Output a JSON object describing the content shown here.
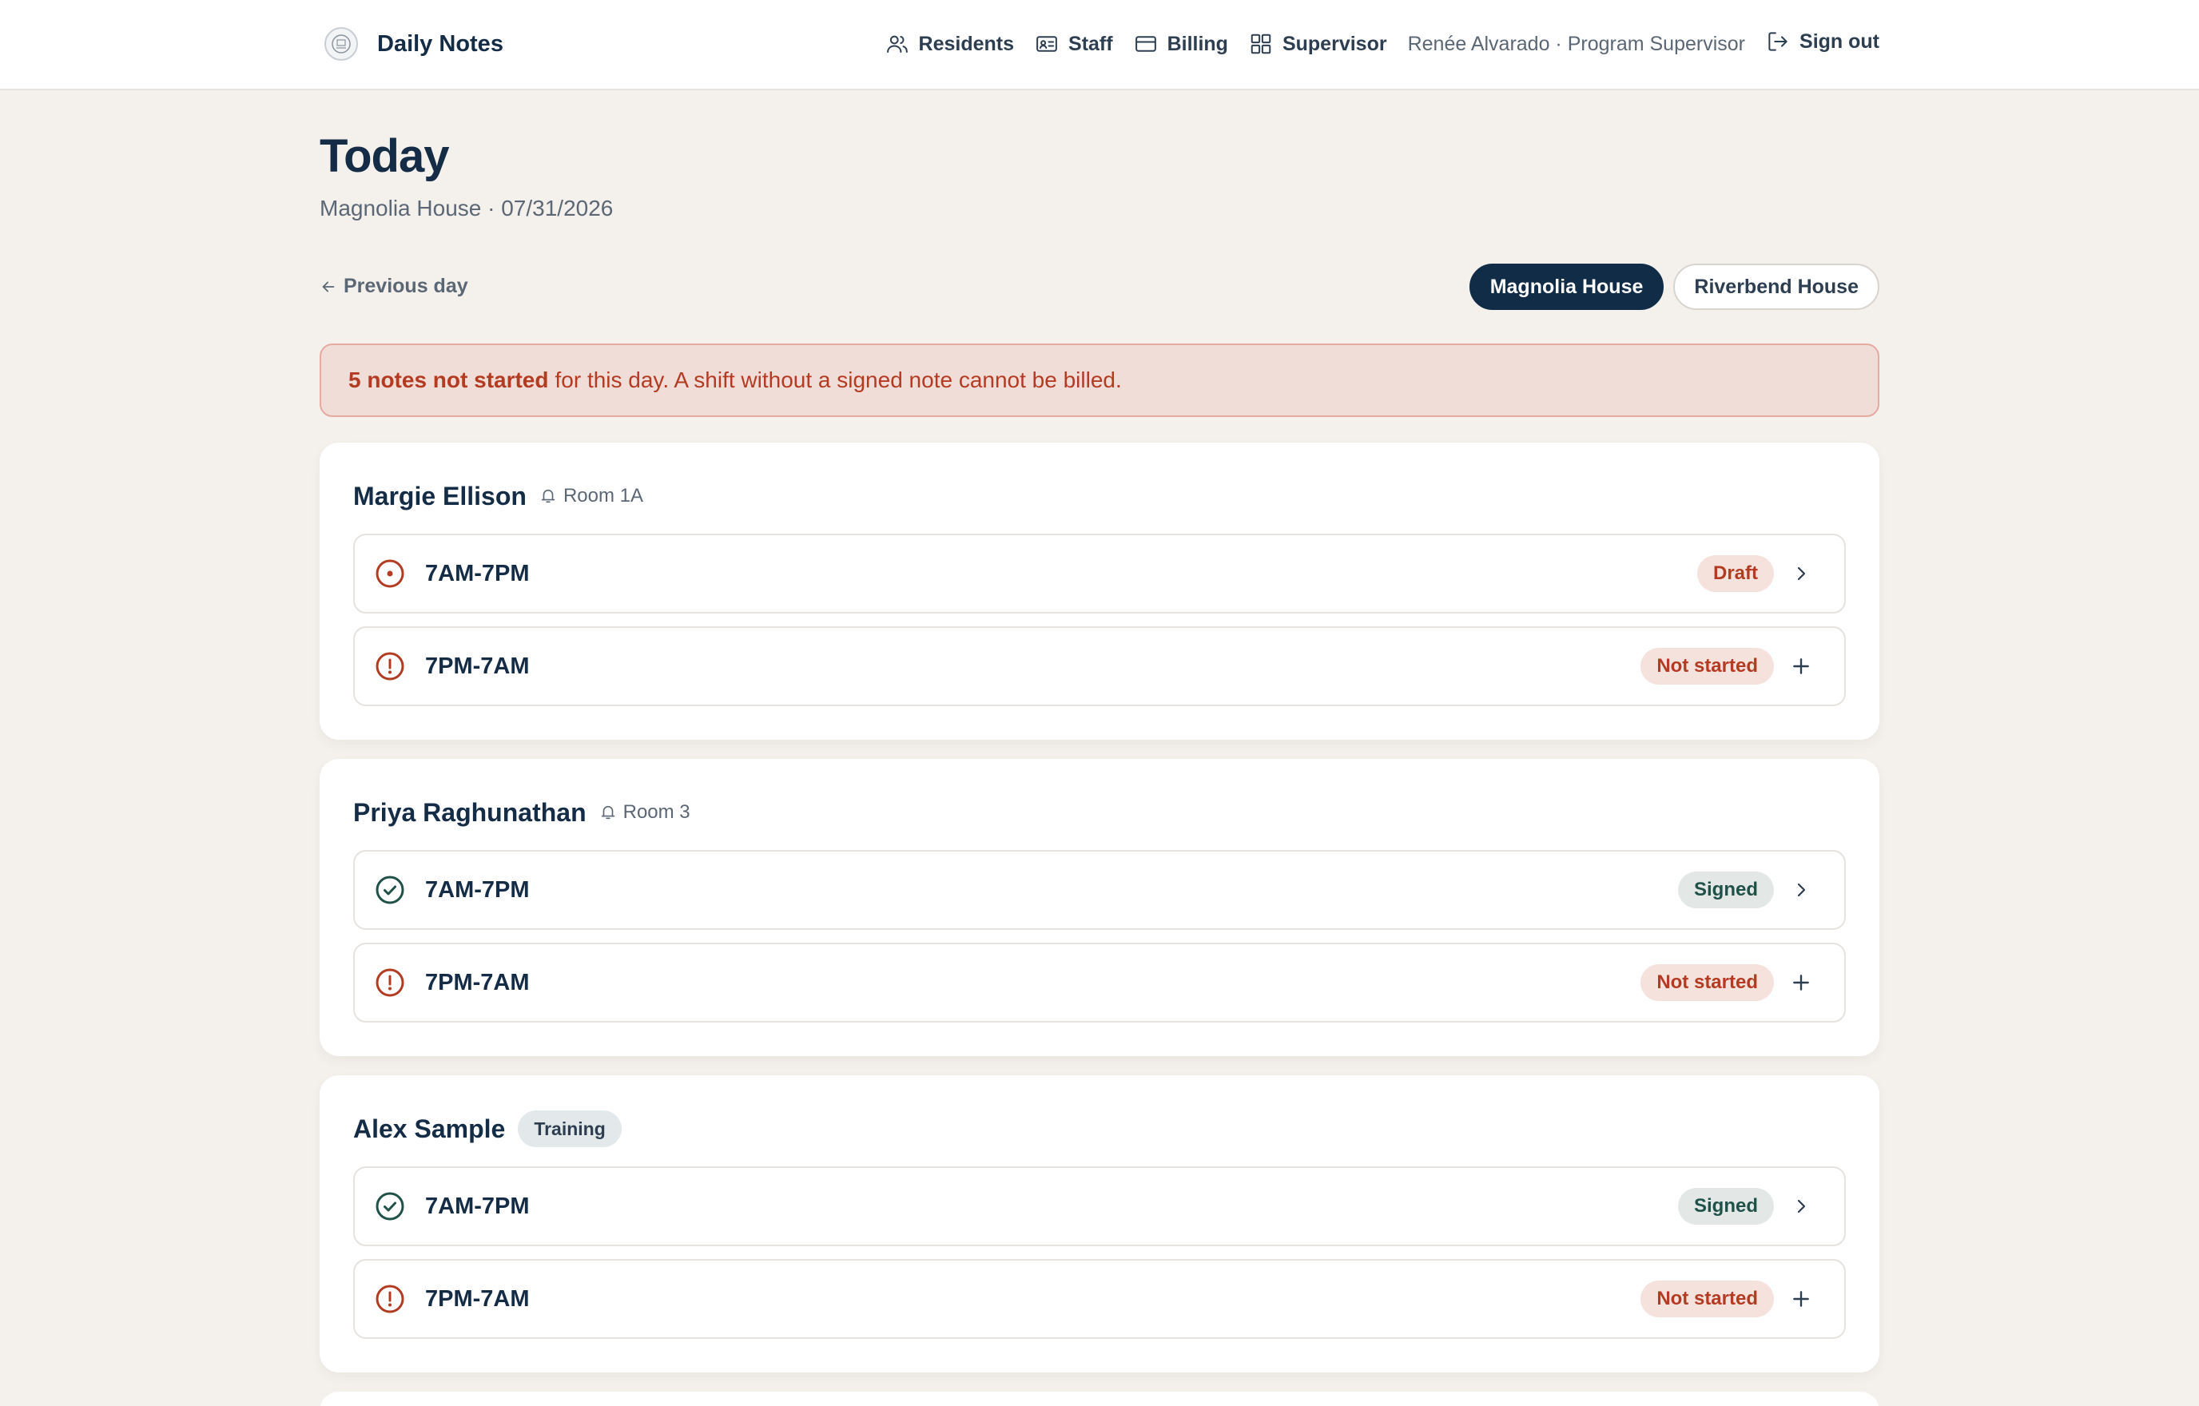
{
  "app": {
    "title": "Daily Notes"
  },
  "nav": {
    "residents": "Residents",
    "staff": "Staff",
    "billing": "Billing",
    "supervisor": "Supervisor",
    "user": "Renée Alvarado · Program Supervisor",
    "sign_out": "Sign out"
  },
  "page": {
    "title": "Today",
    "subtitle": "Magnolia House · 07/31/2026",
    "previous_day": "Previous day"
  },
  "houses": [
    "Magnolia House",
    "Riverbend House"
  ],
  "selected_house": "Magnolia House",
  "alert": {
    "count_text": "5 notes not started",
    "message": "for this day. A shift without a signed note cannot be billed."
  },
  "colors": {
    "primary": "#102c47",
    "danger": "#b23b22",
    "success": "#1f5148",
    "background": "#f4f0ec"
  },
  "residents": [
    {
      "name": "Margie Ellison",
      "room": "Room 1A",
      "shifts": [
        {
          "label": "7AM-7PM",
          "status": "Draft",
          "icon": "draft-circle-icon",
          "action": "chevron-right-icon"
        },
        {
          "label": "7PM-7AM",
          "status": "Not started",
          "icon": "alert-circle-icon",
          "action": "plus-icon"
        }
      ]
    },
    {
      "name": "Priya Raghunathan",
      "room": "Room 3",
      "shifts": [
        {
          "label": "7AM-7PM",
          "status": "Signed",
          "icon": "check-circle-icon",
          "action": "chevron-right-icon"
        },
        {
          "label": "7PM-7AM",
          "status": "Not started",
          "icon": "alert-circle-icon",
          "action": "plus-icon"
        }
      ]
    },
    {
      "name": "Alex Sample",
      "tag": "Training",
      "shifts": [
        {
          "label": "7AM-7PM",
          "status": "Signed",
          "icon": "check-circle-icon",
          "action": "chevron-right-icon"
        },
        {
          "label": "7PM-7AM",
          "status": "Not started",
          "icon": "alert-circle-icon",
          "action": "plus-icon"
        }
      ]
    }
  ]
}
